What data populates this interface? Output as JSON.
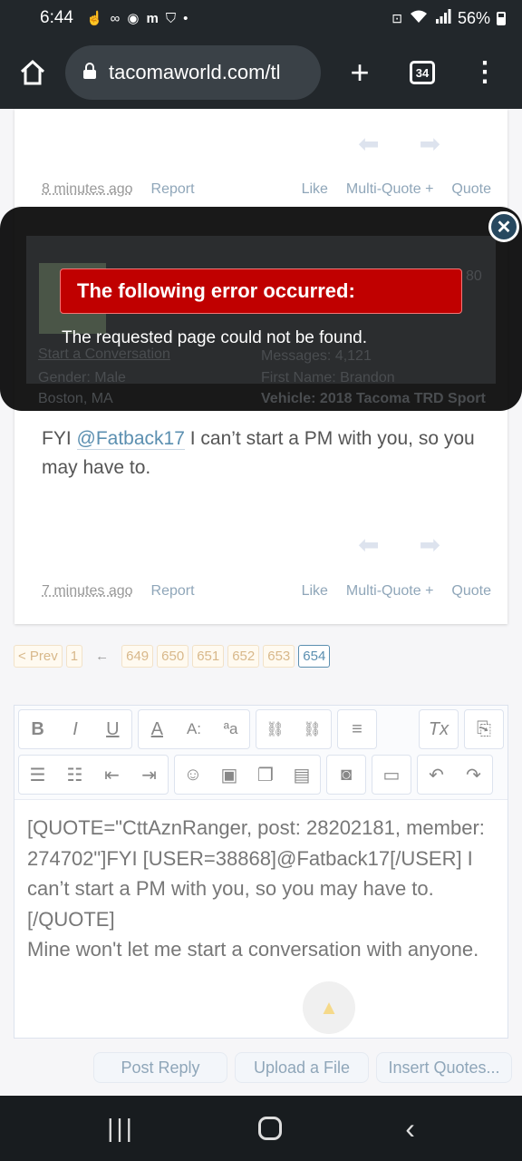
{
  "status_bar": {
    "time": "6:44",
    "battery": "56%",
    "notif_icons": [
      "hand-icon",
      "infinity-icon",
      "circle-check-icon",
      "m-icon",
      "bag-icon",
      "dot-icon"
    ]
  },
  "browser": {
    "url": "tacomaworld.com/tl",
    "tab_count": "34"
  },
  "post1": {
    "time": "8 minutes ago",
    "report": "Report",
    "like": "Like",
    "multiquote": "Multi-Quote +",
    "quote": "Quote"
  },
  "post2": {
    "text_prefix": "FYI ",
    "mention": "@Fatback17",
    "text_suffix": " I can’t start a PM with you, so you may have to.",
    "time": "7 minutes ago",
    "report": "Report",
    "like": "Like",
    "multiquote": "Multi-Quote +",
    "quote": "Quote"
  },
  "overlay": {
    "title": "The following error occurred:",
    "message": "The requested page could not be found.",
    "ghost": {
      "start_conv": "Start a Conversation",
      "gender": "Gender:  Male",
      "location": "Boston, MA",
      "messages": "Messages:  4,121",
      "first_name": "First Name:  Brandon",
      "vehicle": "Vehicle:  2018 Tacoma TRD Sport",
      "badge": "80"
    }
  },
  "pagination": {
    "prev": "< Prev",
    "first": "1",
    "ellipsis": "←",
    "pages": [
      "649",
      "650",
      "651",
      "652",
      "653"
    ],
    "current": "654"
  },
  "editor": {
    "content": "[QUOTE=\"CttAznRanger, post: 28202181, member: 274702\"]FYI [USER=38868]@Fatback17[/USER] I can’t start a PM with you, so you may have to.[/QUOTE]\nMine won't let me start a conversation with anyone."
  },
  "buttons": {
    "post_reply": "Post Reply",
    "upload": "Upload a File",
    "insert_quotes": "Insert Quotes..."
  },
  "colors": {
    "error_red": "#c00000",
    "link": "#5b8fb0",
    "muted_link": "#8fa6b9"
  }
}
